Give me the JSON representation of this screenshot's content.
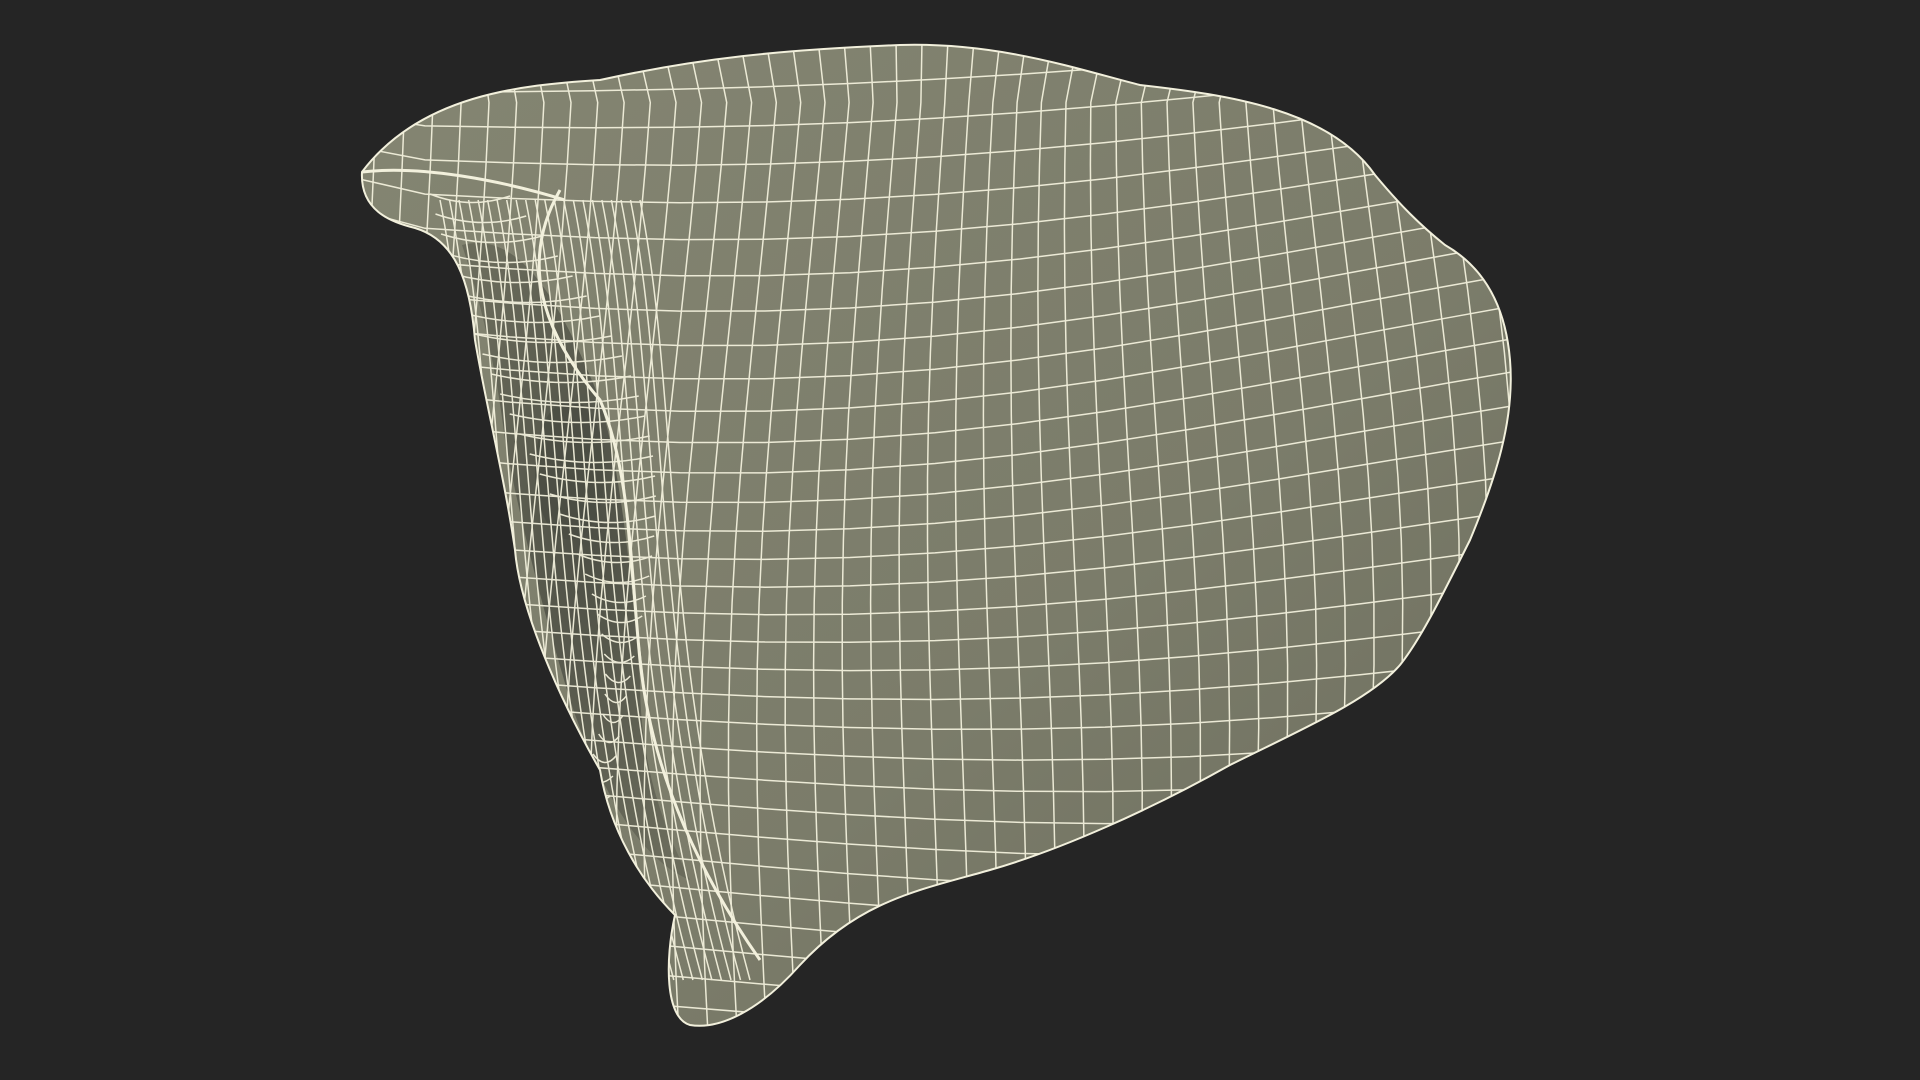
{
  "scene": {
    "subject_icon": "wireframe-mesh-icon",
    "colors": {
      "background": "#252525",
      "surface": "#7d7e6c",
      "surface_shadow": "#5f6152",
      "inner_cavity": "#52544a",
      "wire": "#f2f0dc"
    }
  }
}
